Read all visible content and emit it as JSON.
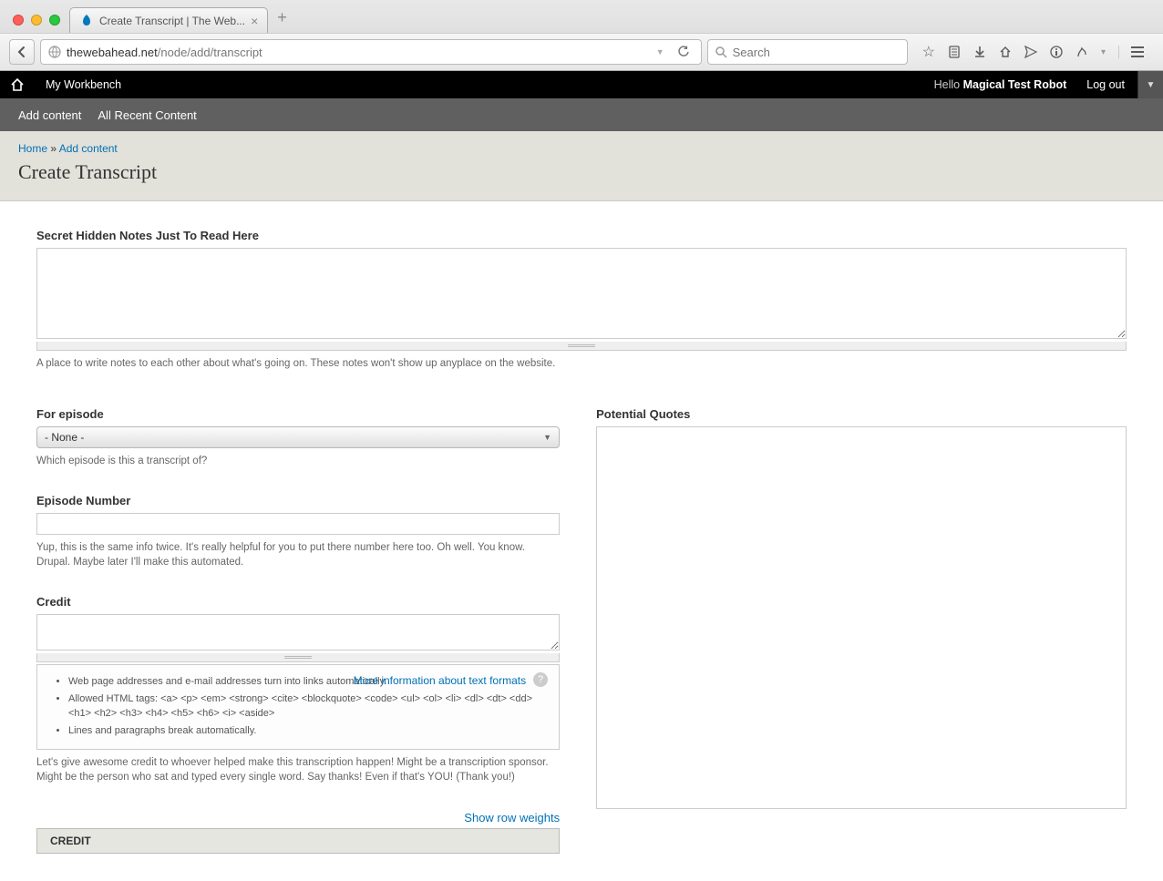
{
  "browser": {
    "tab_title": "Create Transcript | The Web...",
    "url_domain": "thewebahead.net",
    "url_path": "/node/add/transcript",
    "search_placeholder": "Search"
  },
  "admin": {
    "workbench": "My Workbench",
    "hello_prefix": "Hello ",
    "username": "Magical Test Robot",
    "logout": "Log out",
    "add_content": "Add content",
    "all_recent": "All Recent Content"
  },
  "breadcrumb": {
    "home": "Home",
    "sep": " » ",
    "add_content": "Add content"
  },
  "page": {
    "title": "Create Transcript"
  },
  "fields": {
    "secret_label": "Secret Hidden Notes Just To Read Here",
    "secret_help": "A place to write notes to each other about what's going on. These notes won't show up anyplace on the website.",
    "for_episode_label": "For episode",
    "for_episode_value": "- None -",
    "for_episode_help": "Which episode is this a transcript of?",
    "episode_number_label": "Episode Number",
    "episode_number_help": "Yup, this is the same info twice. It's really helpful for you to put there number here too. Oh well. You know. Drupal. Maybe later I'll make this automated.",
    "credit_label": "Credit",
    "credit_help": "Let's give awesome credit to whoever helped make this transcription happen! Might be a transcription sponsor. Might be the person who sat and typed every single word. Say thanks! Even if that's YOU! (Thank you!)",
    "potential_label": "Potential Quotes"
  },
  "format": {
    "more_info": "More information about text formats",
    "tip1": "Web page addresses and e-mail addresses turn into links automatically.",
    "tip2": "Allowed HTML tags: <a> <p> <em> <strong> <cite> <blockquote> <code> <ul> <ol> <li> <dl> <dt> <dd> <h1> <h2> <h3> <h4> <h5> <h6> <i> <aside>",
    "tip3": "Lines and paragraphs break automatically."
  },
  "table": {
    "show_weights": "Show row weights",
    "header_credit": "CREDIT"
  }
}
